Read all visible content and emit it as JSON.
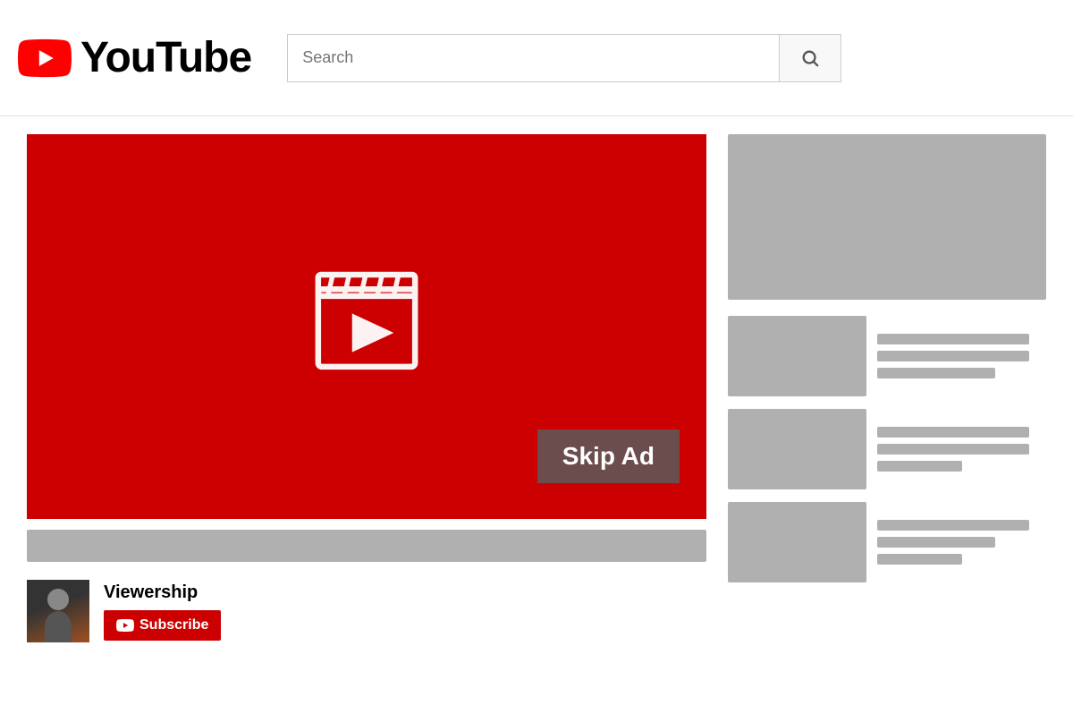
{
  "header": {
    "logo_text": "YouTube",
    "search_placeholder": "Search",
    "search_button_label": "Search"
  },
  "video": {
    "skip_ad_label": "Skip Ad",
    "player_bg": "#cc0000"
  },
  "channel": {
    "name": "Viewership",
    "subscribe_label": "Subscribe"
  },
  "sidebar": {
    "banner_alt": "Advertisement banner",
    "rec_items": [
      {
        "id": 1
      },
      {
        "id": 2
      },
      {
        "id": 3
      }
    ]
  },
  "icons": {
    "search": "🔍",
    "youtube_play": "▶"
  }
}
